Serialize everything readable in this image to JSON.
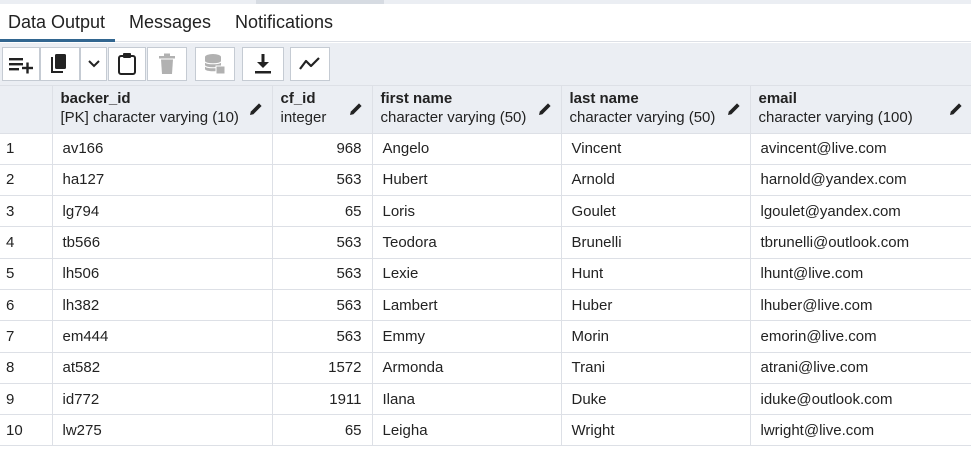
{
  "tabs": [
    {
      "label": "Data Output",
      "active": true
    },
    {
      "label": "Messages",
      "active": false
    },
    {
      "label": "Notifications",
      "active": false
    }
  ],
  "toolbar": {
    "buttons": [
      {
        "icon": "add-row-icon",
        "enabled": true
      },
      {
        "icon": "copy-icon",
        "enabled": true
      },
      {
        "icon": "chevron-down-icon",
        "enabled": true
      },
      {
        "icon": "paste-icon",
        "enabled": true
      },
      {
        "icon": "trash-icon",
        "enabled": false
      },
      {
        "icon": "save-data-icon",
        "enabled": false
      },
      {
        "icon": "download-icon",
        "enabled": true
      },
      {
        "icon": "graph-icon",
        "enabled": true
      }
    ]
  },
  "grid": {
    "columns": [
      {
        "name": "backer_id",
        "type": "[PK] character varying (10)",
        "align": "left"
      },
      {
        "name": "cf_id",
        "type": "integer",
        "align": "right"
      },
      {
        "name": "first name",
        "type": "character varying (50)",
        "align": "left"
      },
      {
        "name": "last name",
        "type": "character varying (50)",
        "align": "left"
      },
      {
        "name": "email",
        "type": "character varying (100)",
        "align": "left"
      }
    ],
    "rows": [
      {
        "n": "1",
        "cells": [
          "av166",
          "968",
          "Angelo",
          "Vincent",
          "avincent@live.com"
        ]
      },
      {
        "n": "2",
        "cells": [
          "ha127",
          "563",
          "Hubert",
          "Arnold",
          "harnold@yandex.com"
        ]
      },
      {
        "n": "3",
        "cells": [
          "lg794",
          "65",
          "Loris",
          "Goulet",
          "lgoulet@yandex.com"
        ]
      },
      {
        "n": "4",
        "cells": [
          "tb566",
          "563",
          "Teodora",
          "Brunelli",
          "tbrunelli@outlook.com"
        ]
      },
      {
        "n": "5",
        "cells": [
          "lh506",
          "563",
          "Lexie",
          "Hunt",
          "lhunt@live.com"
        ]
      },
      {
        "n": "6",
        "cells": [
          "lh382",
          "563",
          "Lambert",
          "Huber",
          "lhuber@live.com"
        ]
      },
      {
        "n": "7",
        "cells": [
          "em444",
          "563",
          "Emmy",
          "Morin",
          "emorin@live.com"
        ]
      },
      {
        "n": "8",
        "cells": [
          "at582",
          "1572",
          "Armonda",
          "Trani",
          "atrani@live.com"
        ]
      },
      {
        "n": "9",
        "cells": [
          "id772",
          "1911",
          "Ilana",
          "Duke",
          "iduke@outlook.com"
        ]
      },
      {
        "n": "10",
        "cells": [
          "lw275",
          "65",
          "Leigha",
          "Wright",
          "lwright@live.com"
        ]
      }
    ]
  },
  "colors": {
    "accent": "#326690",
    "toolbar_bg": "#ebeef3",
    "border": "#dde0e6"
  }
}
